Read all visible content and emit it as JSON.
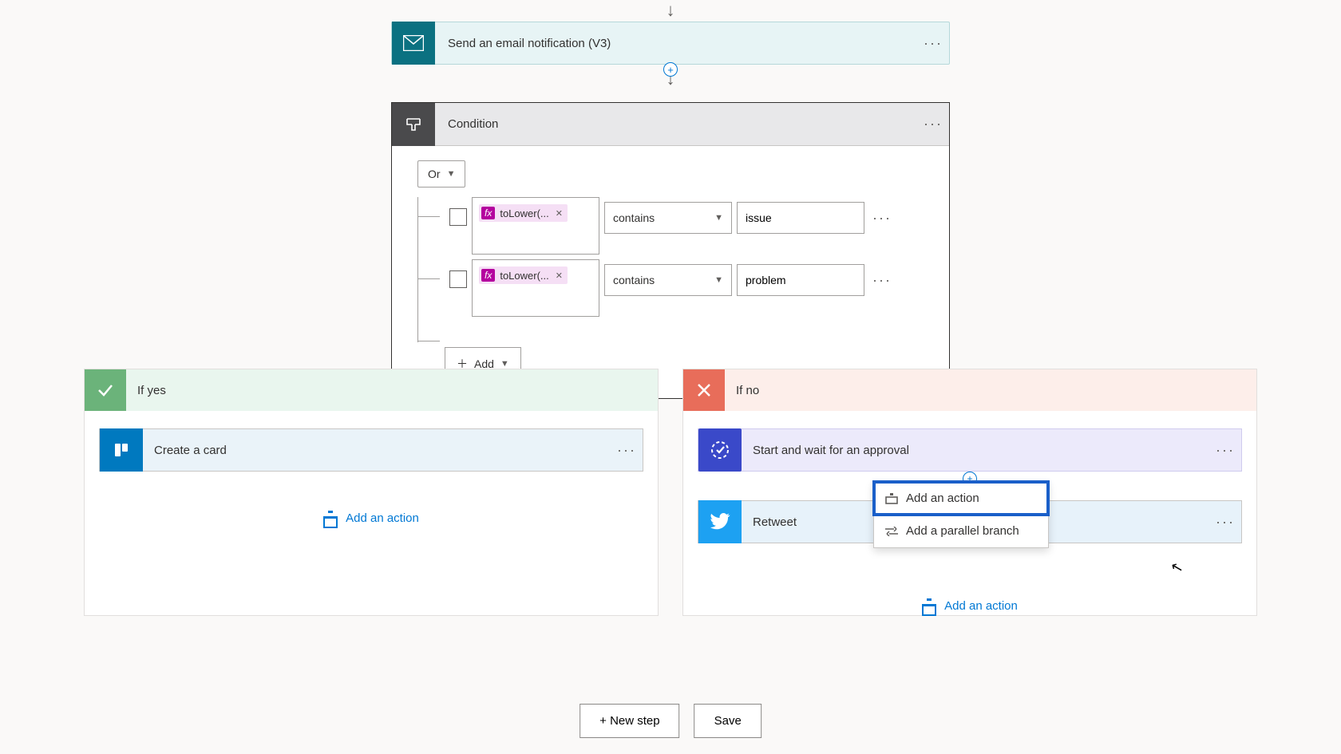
{
  "flow": {
    "email_step": {
      "title": "Send an email notification (V3)"
    },
    "condition": {
      "title": "Condition",
      "group_operator": "Or",
      "rows": [
        {
          "expr_label": "toLower(...",
          "operator": "contains",
          "value": "issue"
        },
        {
          "expr_label": "toLower(...",
          "operator": "contains",
          "value": "problem"
        }
      ],
      "add_label": "Add"
    },
    "branches": {
      "yes": {
        "title": "If yes",
        "steps": [
          {
            "title": "Create a card"
          }
        ],
        "add_action": "Add an action"
      },
      "no": {
        "title": "If no",
        "steps": [
          {
            "title": "Start and wait for an approval"
          },
          {
            "title": "Retweet"
          }
        ],
        "add_action": "Add an action",
        "popup": {
          "add_action": "Add an action",
          "add_parallel": "Add a parallel branch"
        }
      }
    }
  },
  "footer": {
    "new_step": "+ New step",
    "save": "Save"
  }
}
